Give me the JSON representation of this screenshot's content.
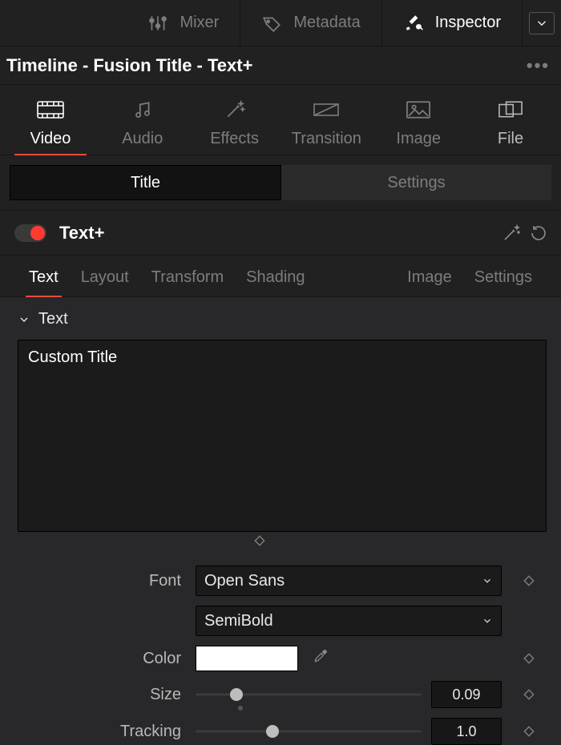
{
  "top_tabs": {
    "mixer": "Mixer",
    "metadata": "Metadata",
    "inspector": "Inspector",
    "active": "inspector"
  },
  "breadcrumb": "Timeline - Fusion Title - Text+",
  "categories": {
    "video": "Video",
    "audio": "Audio",
    "effects": "Effects",
    "transition": "Transition",
    "image": "Image",
    "file": "File",
    "active": "video"
  },
  "segmented": {
    "title": "Title",
    "settings": "Settings",
    "active": "title"
  },
  "effect": {
    "name": "Text+",
    "enabled": true
  },
  "sub_tabs": {
    "text": "Text",
    "layout": "Layout",
    "transform": "Transform",
    "shading": "Shading",
    "image": "Image",
    "settings": "Settings",
    "active": "text"
  },
  "section": {
    "header": "Text"
  },
  "params": {
    "styled_text": "Custom Title",
    "font_label": "Font",
    "font_family": "Open Sans",
    "font_weight": "SemiBold",
    "color_label": "Color",
    "color_value": "#ffffff",
    "size_label": "Size",
    "size_value": "0.09",
    "size_slider_pct": 18,
    "tracking_label": "Tracking",
    "tracking_value": "1.0",
    "tracking_slider_pct": 34
  }
}
